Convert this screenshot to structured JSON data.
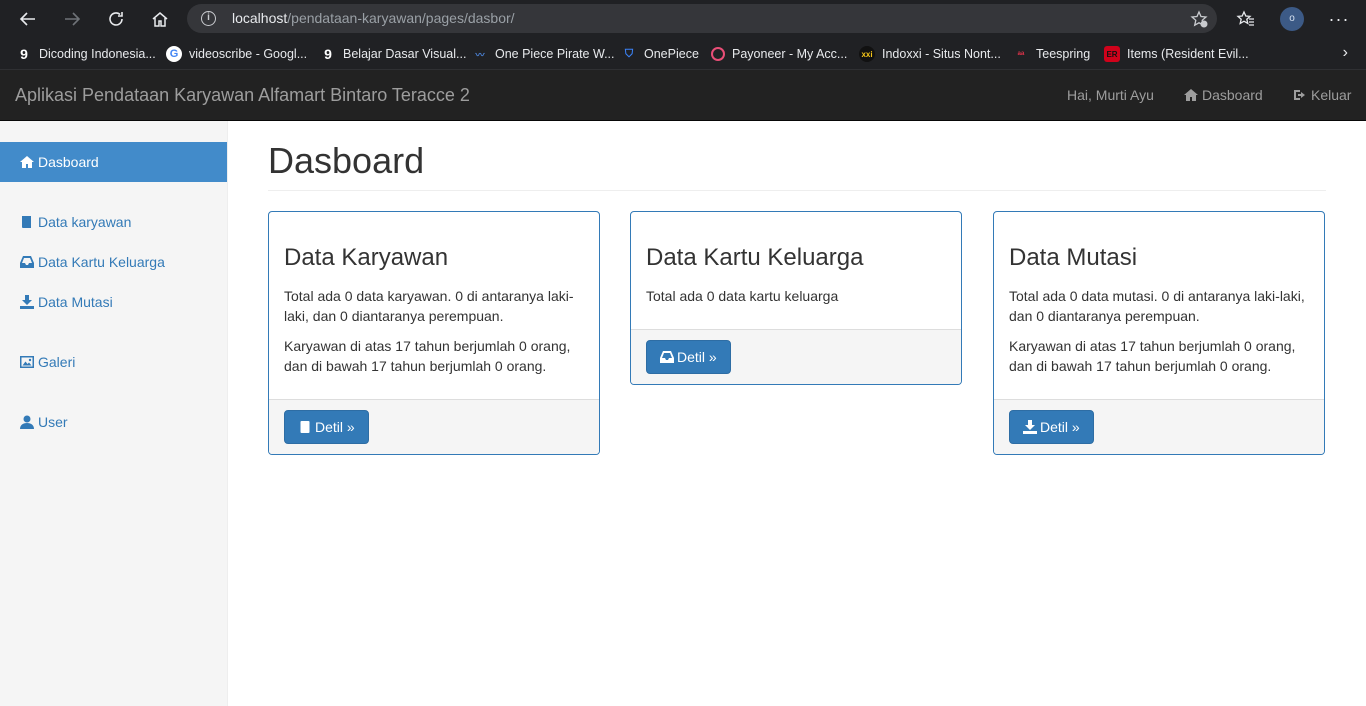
{
  "browser": {
    "url_host": "localhost",
    "url_path": "/pendataan-karyawan/pages/dasbor/",
    "profile_initial": "o",
    "bookmarks": [
      {
        "label": "Dicoding Indonesia...",
        "icon": "dicoding-icon",
        "color": "#ffffff"
      },
      {
        "label": "videoscribe - Googl...",
        "icon": "google-icon",
        "color": "#4285f4"
      },
      {
        "label": "Belajar Dasar Visual...",
        "icon": "dicoding-icon",
        "color": "#ffffff"
      },
      {
        "label": "One Piece Pirate W...",
        "icon": "onepiece-icon",
        "color": "#4a7fd1"
      },
      {
        "label": "OnePiece",
        "icon": "shield-icon",
        "color": "#3b82f6"
      },
      {
        "label": "Payoneer - My Acc...",
        "icon": "payoneer-icon",
        "color": "#e94e77"
      },
      {
        "label": "Indoxxi - Situs Nont...",
        "icon": "indoxxi-icon",
        "color": "#f5c518"
      },
      {
        "label": "Teespring",
        "icon": "teespring-icon",
        "color": "#e2334a"
      },
      {
        "label": "Items (Resident Evil...",
        "icon": "resident-evil-icon",
        "color": "#d0021b"
      }
    ]
  },
  "navbar": {
    "brand": "Aplikasi Pendataan Karyawan Alfamart Bintaro Teracce 2",
    "greeting": "Hai, Murti Ayu",
    "dasboard": "Dasboard",
    "logout": "Keluar"
  },
  "sidebar": {
    "items": [
      {
        "label": "Dasboard",
        "icon": "home-icon"
      },
      {
        "label": "Data karyawan",
        "icon": "book-icon"
      },
      {
        "label": "Data Kartu Keluarga",
        "icon": "inbox-icon"
      },
      {
        "label": "Data Mutasi",
        "icon": "save-icon"
      },
      {
        "label": "Galeri",
        "icon": "picture-icon"
      },
      {
        "label": "User",
        "icon": "user-icon"
      }
    ]
  },
  "main": {
    "title": "Dasboard",
    "panels": [
      {
        "title": "Data Karyawan",
        "text1": "Total ada 0 data karyawan. 0 di antaranya laki-laki, dan 0 diantaranya perempuan.",
        "text2": "Karyawan di atas 17 tahun berjumlah 0 orang, dan di bawah 17 tahun berjumlah 0 orang.",
        "button": "Detil »"
      },
      {
        "title": "Data Kartu Keluarga",
        "text1": "Total ada 0 data kartu keluarga",
        "button": "Detil »"
      },
      {
        "title": "Data Mutasi",
        "text1": "Total ada 0 data mutasi. 0 di antaranya laki-laki, dan 0 diantaranya perempuan.",
        "text2": "Karyawan di atas 17 tahun berjumlah 0 orang, dan di bawah 17 tahun berjumlah 0 orang.",
        "button": "Detil »"
      }
    ]
  },
  "colors": {
    "primary": "#337ab7",
    "navbar_bg": "#222222",
    "sidebar_active": "#428bca"
  }
}
